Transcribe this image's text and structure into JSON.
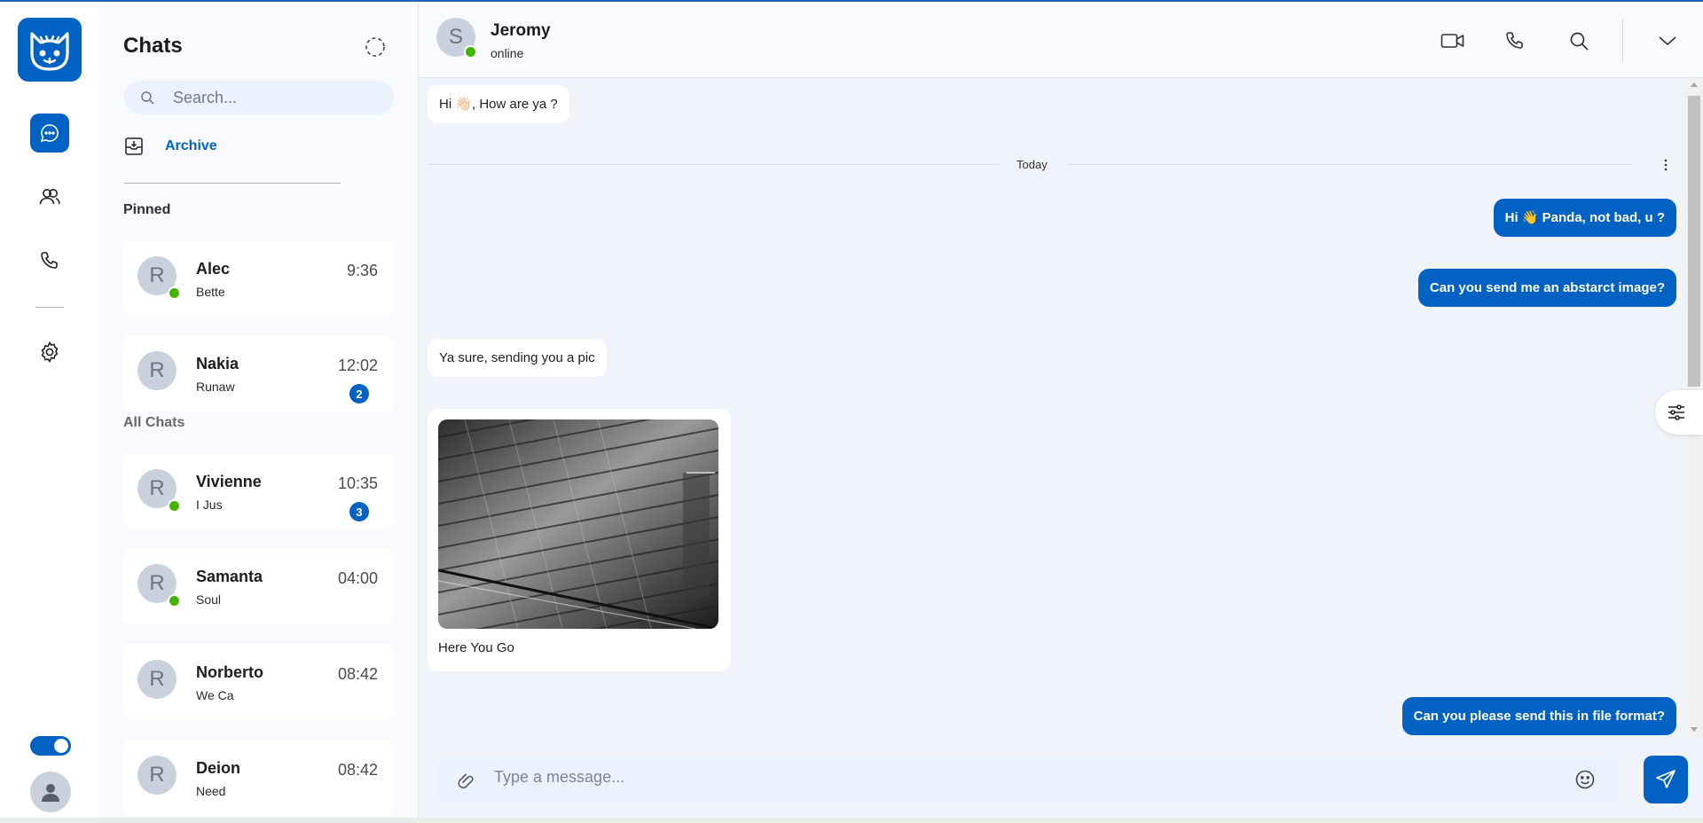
{
  "app": {
    "accent_color": "#0162c4",
    "online_color": "#44b400"
  },
  "rail": {
    "items": [
      {
        "icon": "chat-bubble-icon",
        "active": true
      },
      {
        "icon": "users-icon",
        "active": false
      },
      {
        "icon": "phone-icon",
        "active": false
      },
      {
        "icon": "gear-icon",
        "active": false
      }
    ],
    "theme_toggle_on": true
  },
  "chats": {
    "title": "Chats",
    "search_placeholder": "Search...",
    "archive_label": "Archive",
    "pinned_label": "Pinned",
    "all_label": "All Chats",
    "pinned": [
      {
        "initial": "R",
        "name": "Alec",
        "preview": "Bette",
        "time": "9:36",
        "online": true,
        "unread": ""
      },
      {
        "initial": "R",
        "name": "Nakia",
        "preview": "Runaw",
        "time": "12:02",
        "online": false,
        "unread": "2"
      }
    ],
    "all": [
      {
        "initial": "R",
        "name": "Vivienne",
        "preview": "I Jus",
        "time": "10:35",
        "online": true,
        "unread": "3"
      },
      {
        "initial": "R",
        "name": "Samanta",
        "preview": "Soul",
        "time": "04:00",
        "online": true,
        "unread": ""
      },
      {
        "initial": "R",
        "name": "Norberto",
        "preview": "We Ca",
        "time": "08:42",
        "online": false,
        "unread": ""
      },
      {
        "initial": "R",
        "name": "Deion",
        "preview": "Need",
        "time": "08:42",
        "online": false,
        "unread": ""
      }
    ]
  },
  "conversation": {
    "contact_initial": "S",
    "contact_name": "Jeromy",
    "contact_status": "online",
    "day_divider": "Today",
    "messages": [
      {
        "dir": "in",
        "text": "Hi 👋🏻, How are ya ?"
      },
      {
        "dir": "out",
        "text": "Hi 👋 Panda, not bad, u ?"
      },
      {
        "dir": "out",
        "text": "Can you send me an abstarct image?"
      },
      {
        "dir": "in",
        "text": "Ya sure, sending you a pic"
      },
      {
        "dir": "out",
        "text": "Can you please send this in file format?"
      }
    ],
    "image_caption": "Here You Go",
    "composer_placeholder": "Type a message..."
  }
}
